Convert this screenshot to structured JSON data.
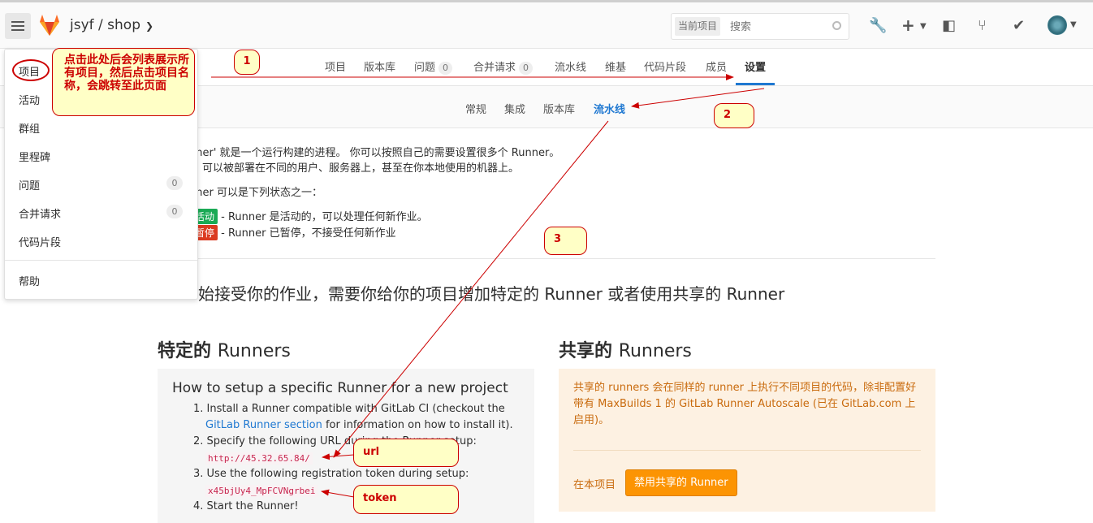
{
  "topbar": {
    "breadcrumb": "jsyf / shop",
    "search_scope": "当前项目",
    "search_placeholder": "搜索"
  },
  "nav_main": [
    "项目",
    "版本库",
    "问题",
    "合并请求",
    "流水线",
    "维基",
    "代码片段",
    "成员",
    "设置"
  ],
  "nav_counts": {
    "issues": "0",
    "merge_requests": "0"
  },
  "nav_settings": [
    "常规",
    "集成",
    "版本库",
    "流水线"
  ],
  "dropdown": {
    "items": [
      "项目",
      "活动",
      "群组",
      "里程碑",
      "问题",
      "合并请求",
      "代码片段",
      "帮助"
    ],
    "issues_count": "0",
    "mr_count": "0"
  },
  "intro": {
    "line1": "nner' 就是一个运行构建的进程。 你可以按照自己的需要设置很多个 Runner。",
    "line2": "可以被部署在不同的用户、服务器上，甚至在你本地使用的机器上。",
    "line3": "nner 可以是下列状态之一：",
    "active_tag": "活动",
    "active_text": "- Runner 是活动的，可以处理任何新作业。",
    "paused_tag": "暂停",
    "paused_text": "- Runner 已暂停，不接受任何新作业",
    "lead": "始接受你的作业，需要你给你的项目增加特定的 Runner 或者使用共享的 Runner"
  },
  "specific": {
    "heading_bold": "特定的",
    "heading_light": "Runners",
    "title": "How to setup a specific Runner for a new project",
    "step1a": "1. Install a Runner compatible with GitLab CI (checkout the",
    "step1_link": "GitLab Runner section",
    "step1b": "for information on how to install it).",
    "step2": "2. Specify the following URL during the Runner setup:",
    "url": "http://45.32.65.84/",
    "step3": "3. Use the following registration token during setup:",
    "token": "x45bjUy4_MpFCVNgrbei",
    "step4": "4. Start the Runner!"
  },
  "shared": {
    "heading_bold": "共享的",
    "heading_light": "Runners",
    "desc": "共享的 runners 会在同样的 runner 上执行不同项目的代码，除非配置好带有 MaxBuilds 1 的 GitLab Runner Autoscale (已在 GitLab.com 上启用)。",
    "label": "在本项目",
    "button": "禁用共享的 Runner"
  },
  "annotations": {
    "note": "点击此处后会列表展示所有项目，然后点击项目名称，会跳转至此页面",
    "n1": "1",
    "n2": "2",
    "n3": "3",
    "url_label": "url",
    "token_label": "token",
    "color": "#cc0000"
  },
  "colors": {
    "accent": "#1f78d1",
    "active_green": "#1aaa55",
    "paused_red": "#db3b21",
    "orange_button": "#fc9403"
  }
}
